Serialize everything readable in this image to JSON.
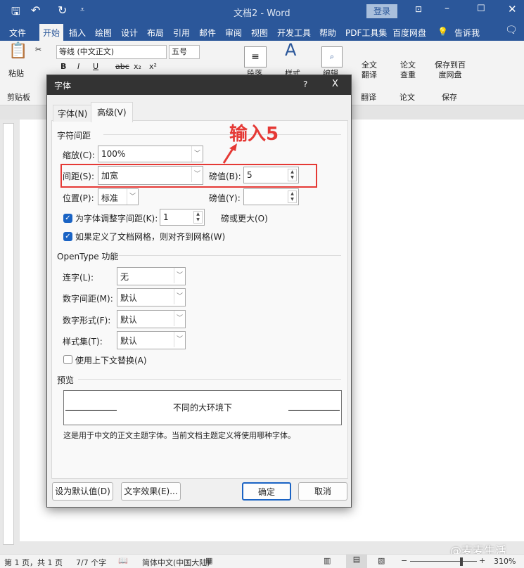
{
  "app": {
    "title": "文档2 - Word",
    "login": "登录"
  },
  "ribbon_tabs": [
    "文件",
    "开始",
    "插入",
    "绘图",
    "设计",
    "布局",
    "引用",
    "邮件",
    "审阅",
    "视图",
    "开发工具",
    "帮助",
    "PDF工具集",
    "百度网盘",
    "告诉我"
  ],
  "ribbon": {
    "paste": "粘贴",
    "clipboard": "剪贴板",
    "font_name": "等线 (中文正文)",
    "font_size": "五号",
    "format_buttons": [
      "B",
      "I",
      "U",
      "abc",
      "x₂",
      "x²"
    ],
    "paragraph": "段落",
    "styles": "样式",
    "edit": "编辑",
    "translate_full": "全文翻译",
    "translate_group": "翻译",
    "paper_check": "论文查重",
    "paper_group": "论文",
    "save_baidu": "保存到百度网盘",
    "save_group": "保存"
  },
  "dialog": {
    "title": "字体",
    "help": "?",
    "close": "X",
    "tabs": [
      {
        "label": "字体(N)",
        "selected": false
      },
      {
        "label": "高级(V)",
        "selected": true
      }
    ],
    "char_spacing": {
      "header": "字符间距",
      "scale_label": "缩放(C):",
      "scale_value": "100%",
      "spacing_label": "间距(S):",
      "spacing_value": "加宽",
      "by_label": "磅值(B):",
      "by_value": "5",
      "position_label": "位置(P):",
      "position_value": "标准",
      "by2_label": "磅值(Y):",
      "by2_value": "",
      "kerning_label": "为字体调整字间距(K):",
      "kerning_checked": true,
      "kerning_value": "1",
      "kerning_suffix": "磅或更大(O)",
      "grid_label": "如果定义了文档网格，则对齐到网格(W)",
      "grid_checked": true
    },
    "opentype": {
      "header": "OpenType 功能",
      "ligatures_label": "连字(L):",
      "ligatures_value": "无",
      "num_spacing_label": "数字间距(M):",
      "num_spacing_value": "默认",
      "num_forms_label": "数字形式(F):",
      "num_forms_value": "默认",
      "stylistic_label": "样式集(T):",
      "stylistic_value": "默认",
      "contextual_label": "使用上下文替换(A)",
      "contextual_checked": false
    },
    "preview": {
      "header": "预览",
      "sample": "不同的大环境下",
      "description": "这是用于中文的正文主题字体。当前文档主题定义将使用哪种字体。"
    },
    "buttons": {
      "set_default": "设为默认值(D)",
      "text_effects": "文字效果(E)...",
      "ok": "确定",
      "cancel": "取消"
    }
  },
  "annotation": {
    "text": "输入5",
    "color": "#e53935"
  },
  "status": {
    "page": "第 1 页，共 1 页",
    "words": "7/7 个字",
    "language": "简体中文(中国大陆)",
    "zoom": "310%",
    "watermark": "@麦麦生活"
  },
  "colors": {
    "brand": "#2b579a",
    "accent": "#1a63c4"
  }
}
